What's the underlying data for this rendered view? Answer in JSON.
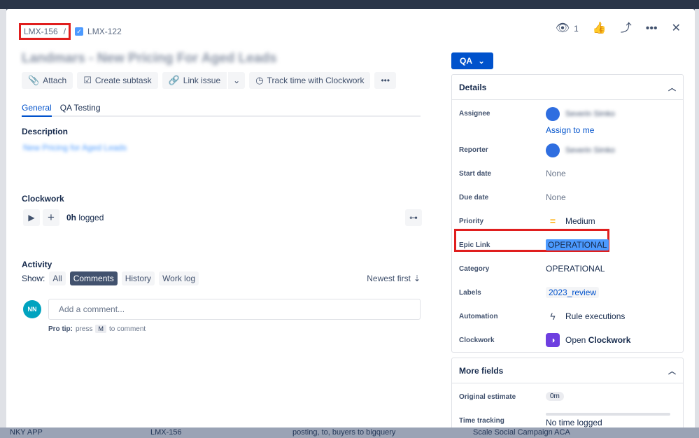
{
  "breadcrumb": {
    "parent_key": "LMX-156",
    "separator": "/",
    "child_key": "LMX-122"
  },
  "toolbar": {
    "watch_count": "1",
    "watch_icon": "eye-icon",
    "like_icon": "thumbs-up-icon",
    "share_icon": "share-icon",
    "more_icon": "more-icon",
    "close_icon": "close-icon"
  },
  "issue": {
    "title": "Landmars - New Pricing For Aged Leads"
  },
  "actions": {
    "attach": "Attach",
    "create_subtask": "Create subtask",
    "link_issue": "Link issue",
    "track_time": "Track time with Clockwork"
  },
  "tabs": [
    {
      "label": "General"
    },
    {
      "label": "QA Testing"
    }
  ],
  "description": {
    "heading": "Description",
    "text": "New Pricing for Aged Leads"
  },
  "clockwork": {
    "heading": "Clockwork",
    "logged_value": "0h",
    "logged_label": "logged"
  },
  "activity": {
    "heading": "Activity",
    "show_label": "Show:",
    "filters": [
      "All",
      "Comments",
      "History",
      "Work log"
    ],
    "active_filter": "Comments",
    "sort": "Newest first",
    "avatar_initials": "NN",
    "comment_placeholder": "Add a comment...",
    "protip_label": "Pro tip:",
    "protip_press": "press",
    "protip_key": "M",
    "protip_suffix": "to comment"
  },
  "status": {
    "label": "QA"
  },
  "details": {
    "heading": "Details",
    "assignee_label": "Assignee",
    "assignee_name": "Severin Simko",
    "assign_to_me": "Assign to me",
    "reporter_label": "Reporter",
    "reporter_name": "Severin Simko",
    "start_date_label": "Start date",
    "start_date_value": "None",
    "due_date_label": "Due date",
    "due_date_value": "None",
    "priority_label": "Priority",
    "priority_value": "Medium",
    "priority_color": "#ffab00",
    "epic_link_label": "Epic Link",
    "epic_link_value": "OPERATIONAL",
    "category_label": "Category",
    "category_value": "OPERATIONAL",
    "labels_label": "Labels",
    "labels_value": "2023_review",
    "automation_label": "Automation",
    "automation_value": "Rule executions",
    "clockwork_label": "Clockwork",
    "clockwork_open": "Open",
    "clockwork_name": "Clockwork"
  },
  "more_fields": {
    "heading": "More fields",
    "original_estimate_label": "Original estimate",
    "original_estimate_value": "0m",
    "time_tracking_label": "Time tracking",
    "time_tracking_value": "No time logged"
  },
  "background": {
    "row1": "LMX-156",
    "row2": "posting, to, buyers to bigquery",
    "row3": "Scale Social Campaign ACA",
    "row4": "NKY APP"
  },
  "colors": {
    "accent": "#0052cc",
    "highlight_border": "#e01e1e",
    "epic_tag": "#4c9aff"
  }
}
